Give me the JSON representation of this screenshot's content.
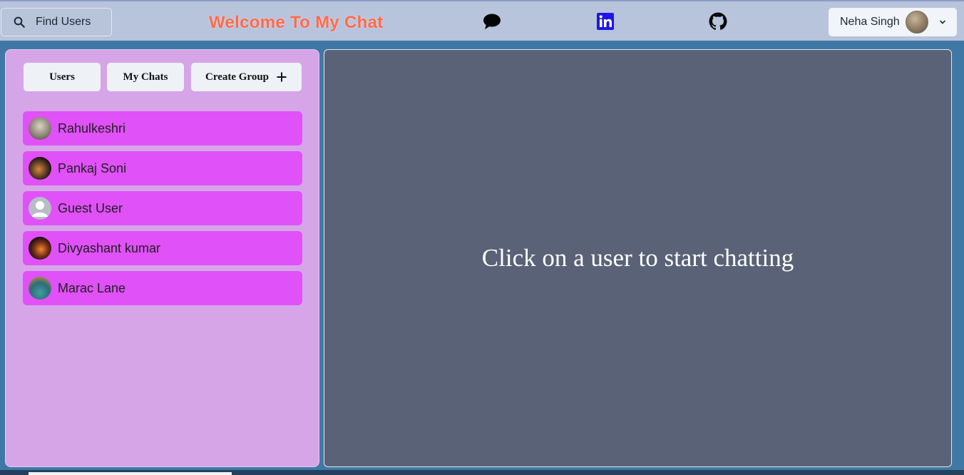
{
  "header": {
    "search_label": "Find Users",
    "title": "Welcome To My Chat",
    "title_color": "#ff6b4a",
    "icons": [
      "chat-bubble-icon",
      "linkedin-icon",
      "github-icon"
    ],
    "profile": {
      "name": "Neha Singh"
    }
  },
  "sidebar": {
    "tabs": {
      "users": "Users",
      "my_chats": "My Chats",
      "create_group": "Create Group"
    },
    "users": [
      {
        "name": "Rahulkeshri"
      },
      {
        "name": "Pankaj Soni"
      },
      {
        "name": "Guest User"
      },
      {
        "name": "Divyashant kumar"
      },
      {
        "name": "Marac Lane"
      }
    ],
    "item_color": "#e051f8"
  },
  "chat": {
    "placeholder": "Click on a user to start chatting"
  }
}
